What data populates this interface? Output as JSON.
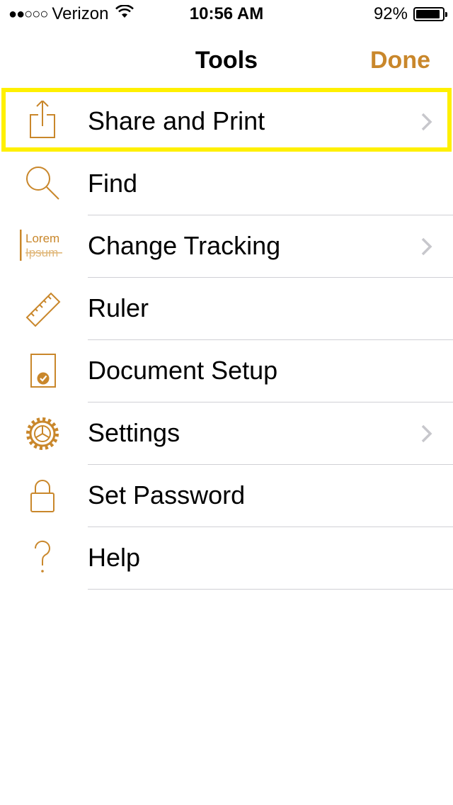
{
  "status_bar": {
    "signal_dots": "●●○○○",
    "carrier": "Verizon",
    "time": "10:56 AM",
    "battery_percent": "92%",
    "battery_level": 0.92
  },
  "navbar": {
    "title": "Tools",
    "done_label": "Done"
  },
  "colors": {
    "accent": "#c9872b",
    "highlight": "#fff000",
    "separator": "#d0d0d5",
    "chevron": "#c7c7cc"
  },
  "menu": {
    "items": [
      {
        "label": "Share and Print",
        "icon": "share-icon",
        "has_chevron": true,
        "highlighted": true
      },
      {
        "label": "Find",
        "icon": "search-icon",
        "has_chevron": false
      },
      {
        "label": "Change Tracking",
        "icon": "change-tracking-icon",
        "has_chevron": true,
        "icon_text_top": "Lorem",
        "icon_text_bottom": "Ipsum"
      },
      {
        "label": "Ruler",
        "icon": "ruler-icon",
        "has_chevron": false
      },
      {
        "label": "Document Setup",
        "icon": "document-setup-icon",
        "has_chevron": false
      },
      {
        "label": "Settings",
        "icon": "gear-icon",
        "has_chevron": true
      },
      {
        "label": "Set Password",
        "icon": "lock-icon",
        "has_chevron": false
      },
      {
        "label": "Help",
        "icon": "question-icon",
        "has_chevron": false
      }
    ]
  }
}
